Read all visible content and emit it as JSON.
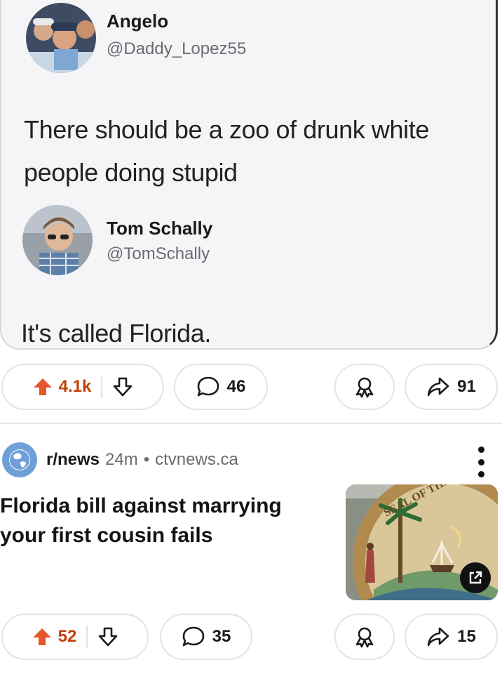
{
  "tweet": {
    "author": {
      "name": "Angelo",
      "handle": "@Daddy_Lopez55"
    },
    "text_line1": "There should be a zoo of drunk white",
    "text_line2": "people doing stupid",
    "quoted": {
      "author": {
        "name": "Tom Schally",
        "handle": "@TomSchally"
      },
      "text": "It's called Florida."
    }
  },
  "post1_actions": {
    "upvotes": "4.1k",
    "comments": "46",
    "shares": "91"
  },
  "post2": {
    "subreddit": "r/news",
    "age": "24m",
    "separator": "•",
    "domain": "ctvnews.ca",
    "title_line1": "Florida bill against marrying",
    "title_line2": "your first cousin fails",
    "thumbnail_icon": "state-seal-image",
    "thumbnail_seal_text": "SEAL OF THE STATE OF F",
    "actions": {
      "upvotes": "52",
      "comments": "35",
      "shares": "15"
    }
  },
  "colors": {
    "upvote": "#e4572e",
    "upvote_count": "#c2410c",
    "muted": "#6b6b70"
  }
}
